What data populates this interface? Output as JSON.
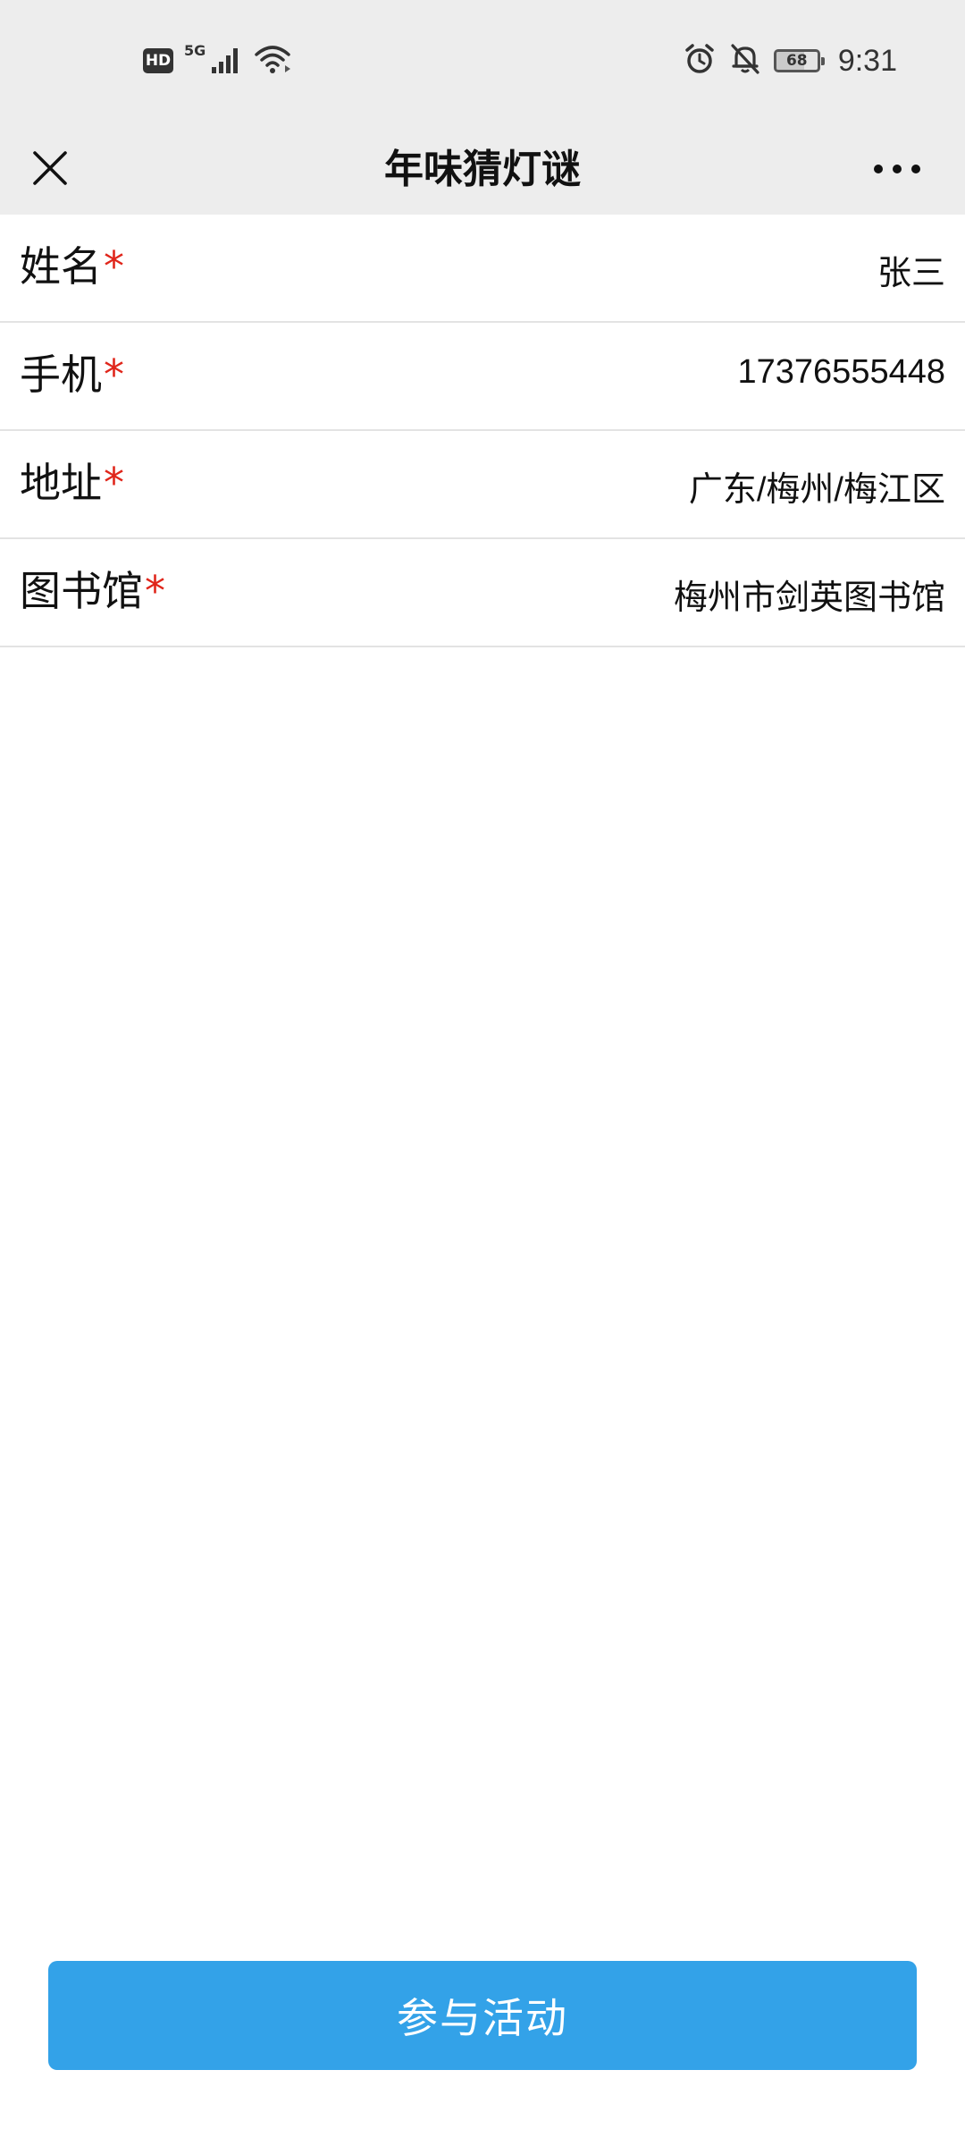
{
  "status_bar": {
    "hd_label": "HD",
    "network_label": "5G",
    "battery_level": 68,
    "battery_text": "68",
    "time": "9:31",
    "icons": [
      "hd-icon",
      "signal-icon",
      "wifi-icon",
      "alarm-icon",
      "mute-bell-icon",
      "battery-icon"
    ]
  },
  "title_bar": {
    "title": "年味猜灯谜",
    "close_icon": "close-icon",
    "more_icon": "more-dots-icon"
  },
  "form": {
    "rows": [
      {
        "label": "姓名",
        "required_mark": "*",
        "value": "张三"
      },
      {
        "label": "手机",
        "required_mark": "*",
        "value": "17376555448"
      },
      {
        "label": "地址",
        "required_mark": "*",
        "value": "广东/梅州/梅江区"
      },
      {
        "label": "图书馆",
        "required_mark": "*",
        "value": "梅州市剑英图书馆"
      }
    ]
  },
  "footer": {
    "join_label": "参与活动"
  },
  "colors": {
    "accent": "#33a2e8",
    "required": "#e0261b",
    "bar_background": "#ededed"
  }
}
